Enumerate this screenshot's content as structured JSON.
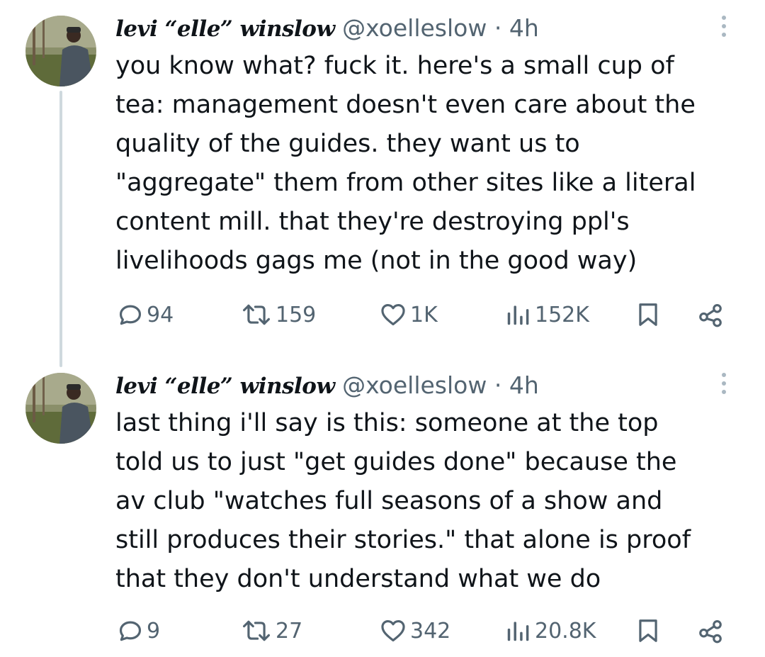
{
  "colors": {
    "text": "#0f1419",
    "secondary": "#536471",
    "thread_line": "#cfd9de"
  },
  "icons": {
    "reply": "reply-icon",
    "repost": "repost-icon",
    "like": "heart-icon",
    "views": "views-icon",
    "bookmark": "bookmark-icon",
    "share": "share-icon",
    "more": "more-vertical-icon"
  },
  "tweets": [
    {
      "display_name": "levi “elle” winslow",
      "handle": "@xoelleslow",
      "separator": "·",
      "time": "4h",
      "text_lines": [
        "you know what? fuck it. here's a small cup of",
        "tea: management doesn't even care about the",
        "quality of the guides. they want us to",
        "\"aggregate\" them from other sites like a literal",
        "content mill. that they're destroying ppl's",
        "livelihoods gags me (not in the good way)"
      ],
      "replies": "94",
      "reposts": "159",
      "likes": "1K",
      "views": "152K"
    },
    {
      "display_name": "levi “elle” winslow",
      "handle": "@xoelleslow",
      "separator": "·",
      "time": "4h",
      "text_lines": [
        "last thing i'll say is this: someone at the top",
        "told us to just \"get guides done\" because the",
        "av club \"watches full seasons of a show and",
        "still produces their stories.\" that alone is proof",
        "that they don't understand what we do"
      ],
      "replies": "9",
      "reposts": "27",
      "likes": "342",
      "views": "20.8K"
    }
  ]
}
